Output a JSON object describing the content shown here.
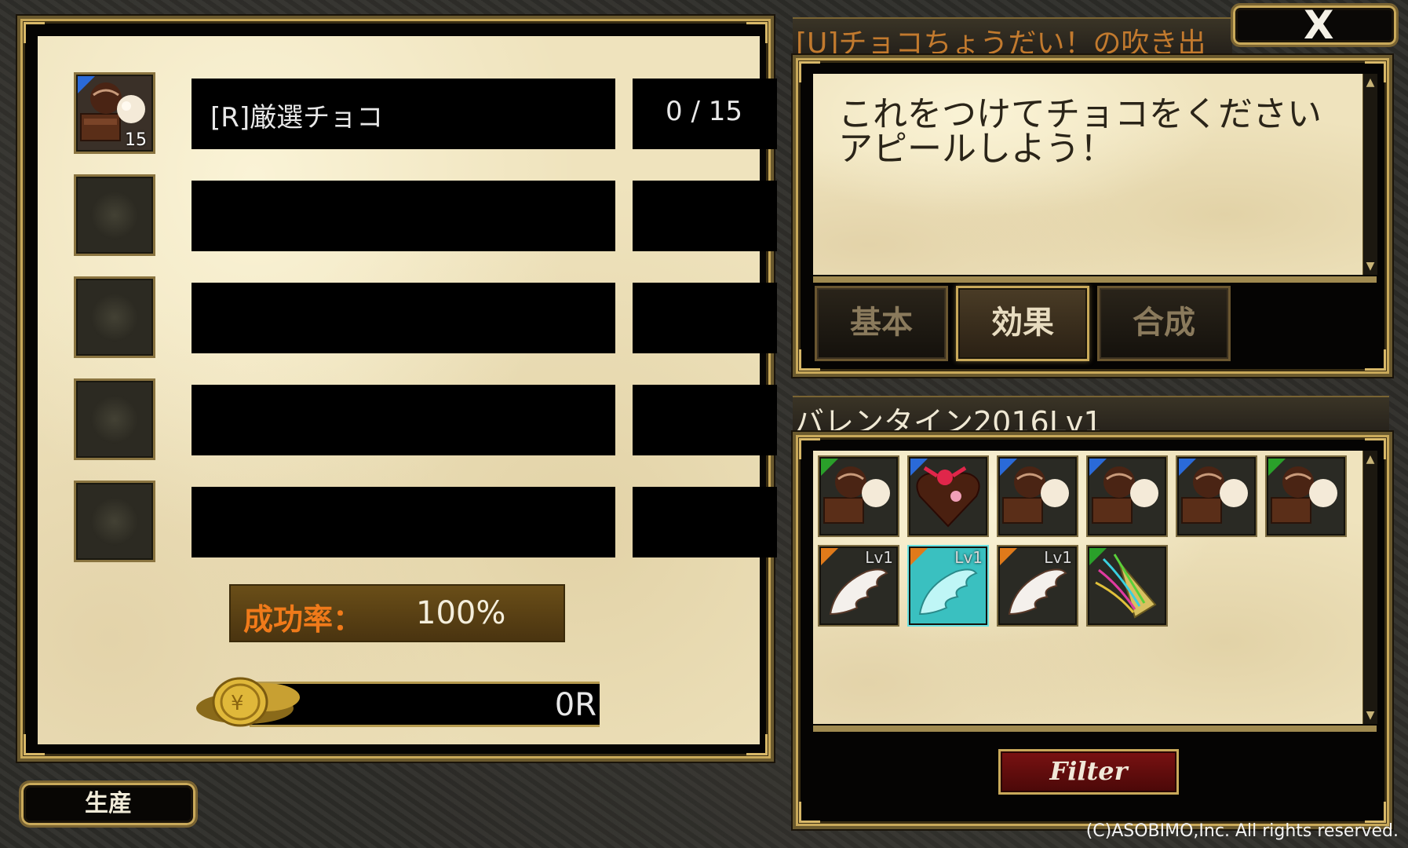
{
  "materials": {
    "rows": [
      {
        "name": "[R]厳選チョコ",
        "quantity": "0 / 15",
        "stack": "15",
        "icon": "chocolate-box-icon",
        "rarity_color": "#2a6ad8"
      },
      {
        "name": "",
        "quantity": "",
        "stack": "",
        "icon": "empty-slot-icon"
      },
      {
        "name": "",
        "quantity": "",
        "stack": "",
        "icon": "empty-slot-icon"
      },
      {
        "name": "",
        "quantity": "",
        "stack": "",
        "icon": "empty-slot-icon"
      },
      {
        "name": "",
        "quantity": "",
        "stack": "",
        "icon": "empty-slot-icon"
      }
    ]
  },
  "success_rate": {
    "label": "成功率：",
    "value": "100%"
  },
  "cost": {
    "value": "0R",
    "icon": "gold-coin-icon"
  },
  "produce_button": {
    "label": "生産"
  },
  "detail": {
    "title": "[U]チョコちょうだい！の吹き出",
    "close_label": "X",
    "description": "これをつけてチョコをくださいアピールしよう！",
    "tabs": [
      {
        "label": "基本",
        "active": false
      },
      {
        "label": "効果",
        "active": true
      },
      {
        "label": "合成",
        "active": false
      }
    ]
  },
  "recipe_list": {
    "category": "バレンタイン2016Lv1",
    "items": [
      {
        "icon": "chocolate-box-icon",
        "rarity_color": "#2aa02a",
        "level": ""
      },
      {
        "icon": "heart-chocolate-icon",
        "rarity_color": "#2a6ad8",
        "level": ""
      },
      {
        "icon": "chocolate-box-icon",
        "rarity_color": "#2a6ad8",
        "level": ""
      },
      {
        "icon": "chocolate-box-icon",
        "rarity_color": "#2a6ad8",
        "level": ""
      },
      {
        "icon": "chocolate-box-icon",
        "rarity_color": "#2a6ad8",
        "level": ""
      },
      {
        "icon": "chocolate-box-icon",
        "rarity_color": "#2aa02a",
        "level": ""
      },
      {
        "icon": "white-wing-icon",
        "rarity_color": "#e07a1a",
        "level": "Lv1"
      },
      {
        "icon": "white-wing-icon",
        "rarity_color": "#e07a1a",
        "level": "Lv1",
        "selected": true
      },
      {
        "icon": "white-wing-icon",
        "rarity_color": "#e07a1a",
        "level": "Lv1"
      },
      {
        "icon": "party-popper-icon",
        "rarity_color": "#2aa02a",
        "level": ""
      }
    ]
  },
  "filter_button": {
    "label": "Filter"
  },
  "copyright": "(C)ASOBIMO,Inc. All rights reserved."
}
